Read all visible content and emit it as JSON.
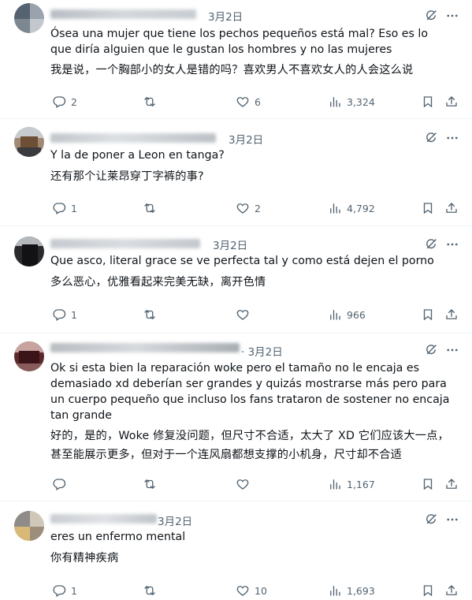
{
  "tweets": [
    {
      "date": "3月2日",
      "text": "Ósea una mujer que tiene los pechos pequeños está mal? Eso es lo que diría alguien que le gustan los hombres y no las mujeres",
      "translation": "我是说，一个胸部小的女人是错的吗？喜欢男人不喜欢女人的人会这么说",
      "replies": "2",
      "retweets": "",
      "likes": "6",
      "views": "3,324"
    },
    {
      "date": "3月2日",
      "text": "Y la de poner a Leon en tanga?",
      "translation": "还有那个让莱昂穿丁字裤的事?",
      "replies": "1",
      "retweets": "",
      "likes": "2",
      "views": "4,792"
    },
    {
      "date": "3月2日",
      "text": "Que asco, literal grace se ve perfecta tal y como está dejen el porno",
      "translation": "多么恶心，优雅看起来完美无缺，离开色情",
      "replies": "1",
      "retweets": "",
      "likes": "",
      "views": "966"
    },
    {
      "date": "· 3月2日",
      "text": "Ok si esta bien la reparación woke pero el tamaño no le encaja es demasiado xd deberían ser grandes y quizás mostrarse más pero para un cuerpo pequeño que incluso los fans trataron de sostener no encaja tan grande",
      "translation": "好的，是的，Woke 修复没问题，但尺寸不合适，太大了 XD 它们应该大一点，甚至能展示更多，但对于一个连风扇都想支撑的小机身，尺寸却不合适",
      "replies": "",
      "retweets": "",
      "likes": "",
      "views": "1,167"
    },
    {
      "date": "3月2日",
      "text": "eres un enfermo mental",
      "translation": "你有精神疾病",
      "replies": "1",
      "retweets": "",
      "likes": "10",
      "views": "1,693"
    }
  ],
  "icons": {
    "reply": "reply-icon",
    "retweet": "retweet-icon",
    "like": "like-icon",
    "views": "views-icon",
    "bookmark": "bookmark-icon",
    "share": "share-icon",
    "grok": "grok-icon",
    "more": "more-icon"
  },
  "colors": {
    "muted": "#536471",
    "text": "#0f1419",
    "divider": "#eff3f4"
  }
}
